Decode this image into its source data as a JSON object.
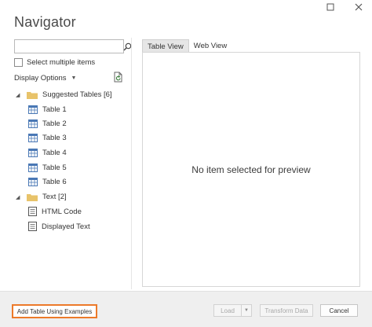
{
  "window": {
    "title": "Navigator"
  },
  "search": {
    "value": "",
    "placeholder": ""
  },
  "options": {
    "select_multiple_label": "Select multiple items",
    "display_options_label": "Display Options"
  },
  "tree": {
    "suggested_group": "Suggested Tables [6]",
    "tables": [
      "Table 1",
      "Table 2",
      "Table 3",
      "Table 4",
      "Table 5",
      "Table 6"
    ],
    "text_group": "Text [2]",
    "texts": [
      "HTML Code",
      "Displayed Text"
    ]
  },
  "preview": {
    "tabs": [
      "Table View",
      "Web View"
    ],
    "active_tab": "Table View",
    "empty_message": "No item selected for preview"
  },
  "footer": {
    "add_table_label": "Add Table Using Examples",
    "load_label": "Load",
    "transform_label": "Transform Data",
    "cancel_label": "Cancel"
  },
  "colors": {
    "highlight": "#ec7a2a",
    "folder": "#e8c36a",
    "table_icon": "#4a78b5"
  },
  "icons": {
    "search": "search-icon",
    "refresh": "refresh-icon",
    "folder": "folder-icon",
    "table": "table-icon",
    "document": "document-icon"
  }
}
